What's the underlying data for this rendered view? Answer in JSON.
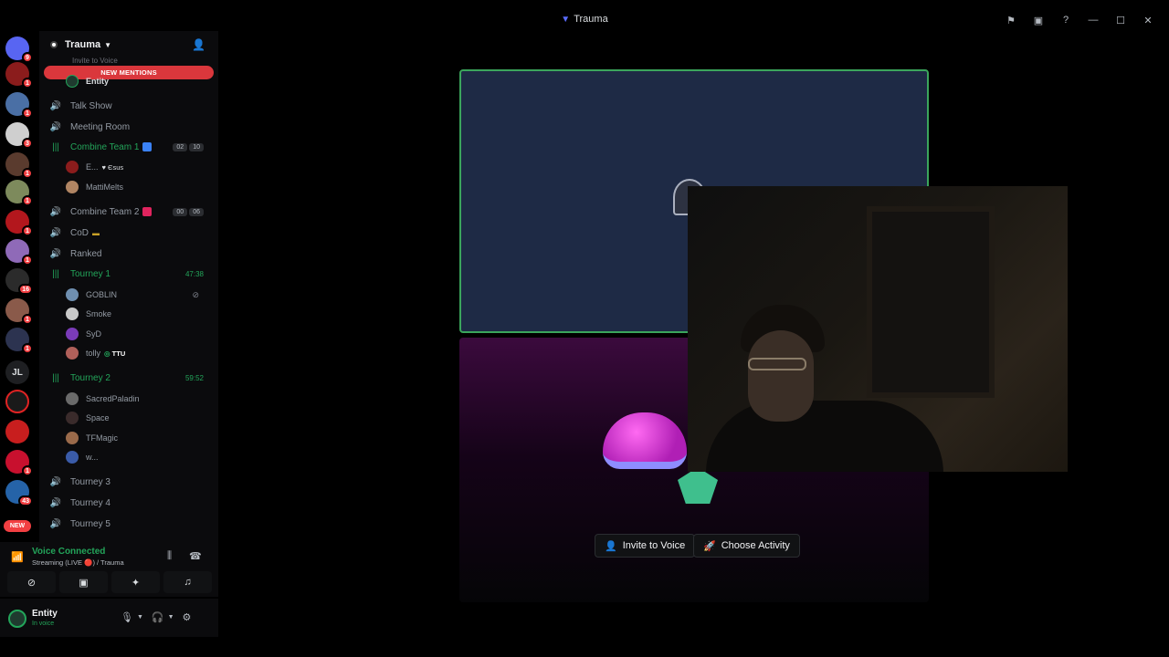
{
  "window": {
    "title": "Trauma"
  },
  "servers": {
    "items": [
      {
        "badge": "9"
      },
      {
        "badge": "1"
      },
      {
        "badge": "1"
      },
      {
        "badge": "3"
      },
      {
        "badge": "1"
      },
      {
        "badge": "1"
      },
      {
        "badge": "1"
      },
      {
        "badge": "1"
      },
      {
        "badge": "16"
      },
      {
        "badge": "1"
      },
      {
        "badge": "1"
      },
      {
        "label": "JL"
      },
      {
        "badge": ""
      },
      {
        "badge": ""
      },
      {
        "badge": "1"
      },
      {
        "badge": "43"
      }
    ],
    "new_label": "NEW"
  },
  "guild": {
    "name": "Trauma",
    "invite_line": "Invite to Voice",
    "new_mentions": "NEW MENTIONS"
  },
  "channels": [
    {
      "name": "Talk Show"
    },
    {
      "name": "Meeting Room"
    },
    {
      "name": "Combine Team 1",
      "pill_a": "02",
      "pill_b": "10"
    },
    {
      "name": "Combine Team 2",
      "pill_a": "00",
      "pill_b": "06"
    },
    {
      "name": "CoD"
    },
    {
      "name": "Ranked"
    },
    {
      "name": "Tourney 1",
      "timer": "47:38"
    },
    {
      "name": "Tourney 2",
      "timer": "59:52"
    },
    {
      "name": "Tourney 3"
    },
    {
      "name": "Tourney 4"
    },
    {
      "name": "Tourney 5"
    }
  ],
  "members": {
    "entity_top": "Entity",
    "combine1": [
      {
        "name": "E...",
        "tag": "♥ Єsus"
      },
      {
        "name": "MattiMelts"
      }
    ],
    "tourney1": [
      {
        "name": "GOBLIN"
      },
      {
        "name": "Smoke"
      },
      {
        "name": "SyD"
      },
      {
        "name": "tolly",
        "tag": "TTU"
      }
    ],
    "tourney2": [
      {
        "name": "SacredPaladin"
      },
      {
        "name": "Space"
      },
      {
        "name": "TFMagic"
      },
      {
        "name": "w..."
      }
    ]
  },
  "voice": {
    "status": "Voice Connected",
    "sub": "Streaming (LIVE 🔴) / Trauma"
  },
  "user": {
    "name": "Entity",
    "status": "In voice"
  },
  "stage": {
    "invite_label": "Invite to Voice",
    "activity_label": "Choose Activity"
  },
  "colors": {
    "live_green": "#23a55a",
    "accent_red": "#f23f42",
    "team1_square": "#3b82f6",
    "team2_square": "#e0245e"
  }
}
